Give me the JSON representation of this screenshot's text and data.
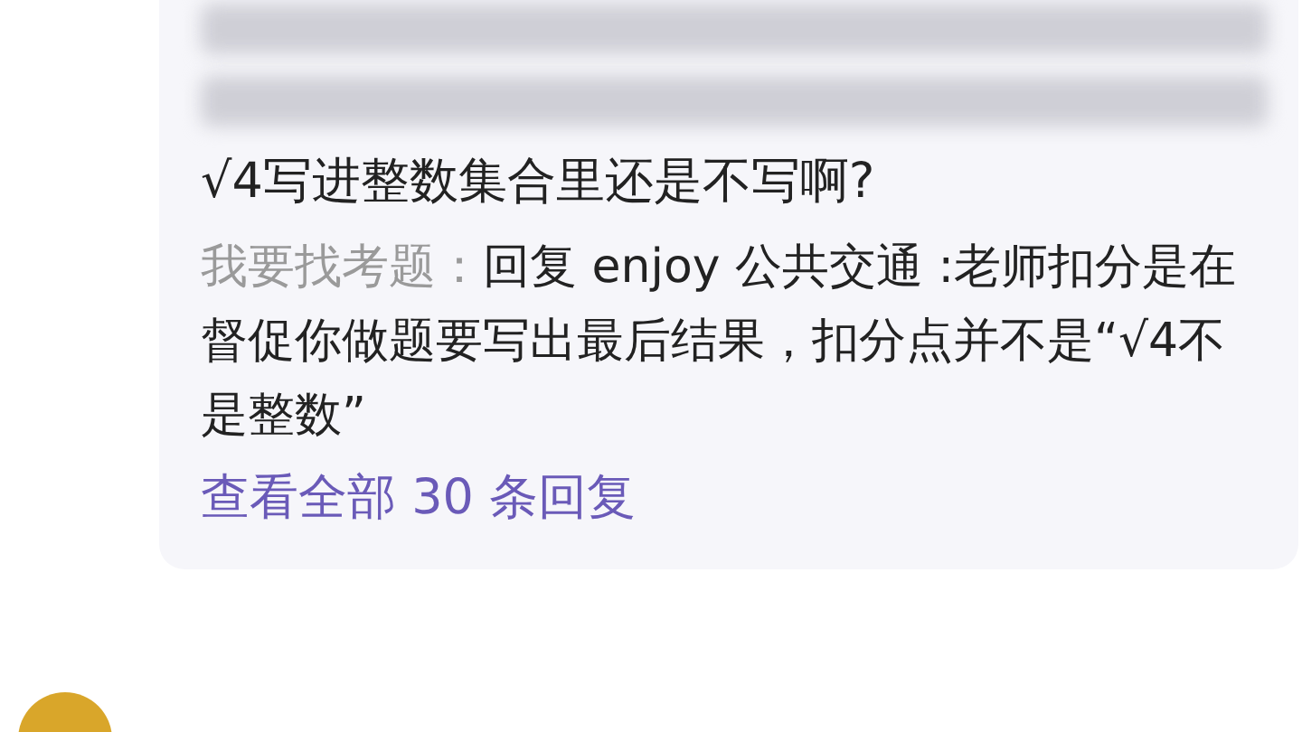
{
  "comment_thread": {
    "question_tail": "√4写进整数集合里还是不写啊?",
    "replies": [
      {
        "author": "我要找考题",
        "separator": "：",
        "text": "回复 enjoy 公共交通 :老师扣分是在督促你做题要写出最后结果，扣分点并不是“√4不是整数”"
      }
    ],
    "view_all": "查看全部 30 条回复"
  }
}
